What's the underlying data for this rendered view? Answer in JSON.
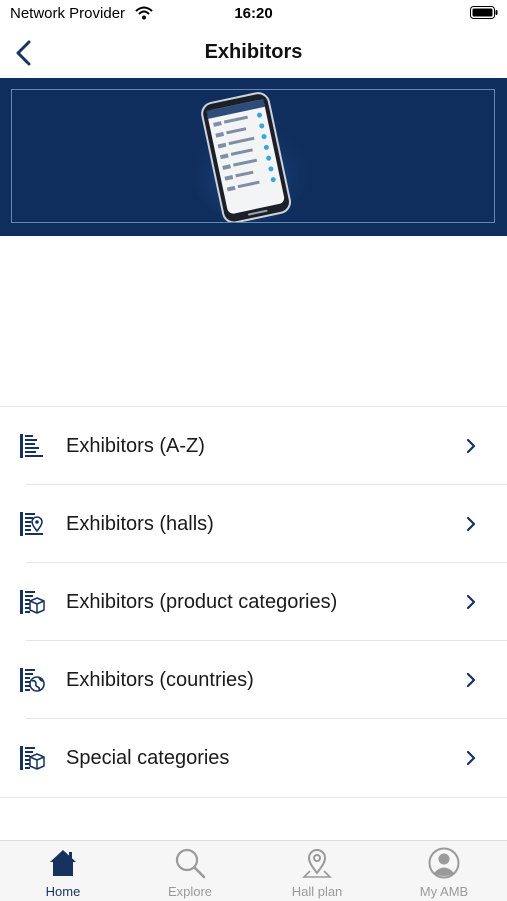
{
  "status_bar": {
    "carrier": "Network Provider",
    "time": "16:20"
  },
  "nav": {
    "title": "Exhibitors"
  },
  "menu": {
    "items": [
      {
        "label": "Exhibitors (A-Z)",
        "icon": "list-az-icon"
      },
      {
        "label": "Exhibitors (halls)",
        "icon": "list-location-icon"
      },
      {
        "label": "Exhibitors (product categories)",
        "icon": "list-box-icon"
      },
      {
        "label": "Exhibitors (countries)",
        "icon": "list-globe-icon"
      },
      {
        "label": "Special categories",
        "icon": "list-box-icon"
      }
    ]
  },
  "tab_bar": {
    "tabs": [
      {
        "label": "Home",
        "icon": "home-icon",
        "active": true
      },
      {
        "label": "Explore",
        "icon": "search-icon",
        "active": false
      },
      {
        "label": "Hall plan",
        "icon": "map-pin-icon",
        "active": false
      },
      {
        "label": "My AMB",
        "icon": "profile-icon",
        "active": false
      }
    ]
  },
  "colors": {
    "brand_navy": "#0f2e5e",
    "icon_navy": "#16335f",
    "inactive_gray": "#9a9a9a"
  }
}
